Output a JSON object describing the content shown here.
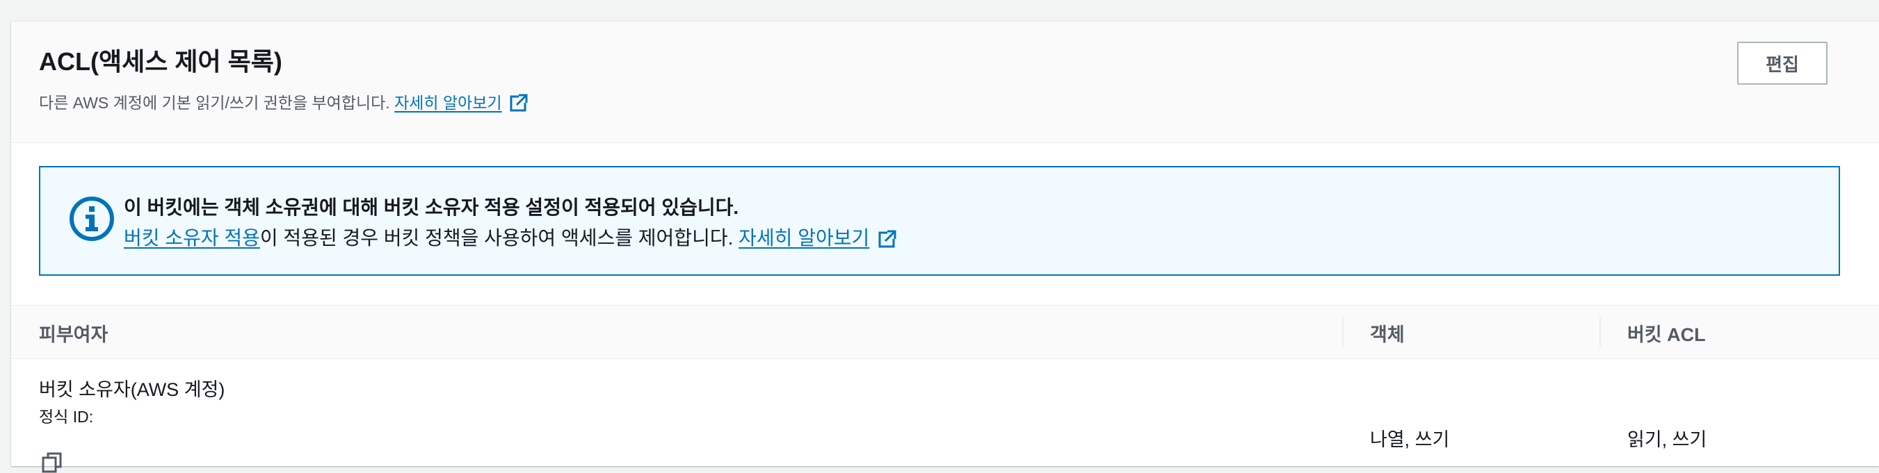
{
  "panel": {
    "title": "ACL(액세스 제어 목록)",
    "description": "다른 AWS 계정에 기본 읽기/쓰기 권한을 부여합니다.",
    "learn_more": "자세히 알아보기",
    "edit_label": "편집"
  },
  "alert": {
    "title": "이 버킷에는 객체 소유권에 대해 버킷 소유자 적용 설정이 적용되어 있습니다.",
    "body_link": "버킷 소유자 적용",
    "body_text": "이 적용된 경우 버킷 정책을 사용하여 액세스를 제어합니다.",
    "learn_more": "자세히 알아보기"
  },
  "table": {
    "headers": [
      "피부여자",
      "객체",
      "버킷 ACL"
    ],
    "rows": [
      {
        "grantee": "버킷 소유자(AWS 계정)",
        "canonical_label": "정식 ID:",
        "canonical_id": "",
        "object_perms": "나열, 쓰기",
        "bucket_acl_perms": "읽기, 쓰기"
      }
    ]
  },
  "colors": {
    "link": "#0073bb",
    "alert_bg": "#f1faff",
    "alert_border": "#0073bb",
    "header_bg": "#fafafa"
  },
  "icons": {
    "external_link": "external-link-icon",
    "info": "info-icon",
    "copy": "copy-icon"
  }
}
